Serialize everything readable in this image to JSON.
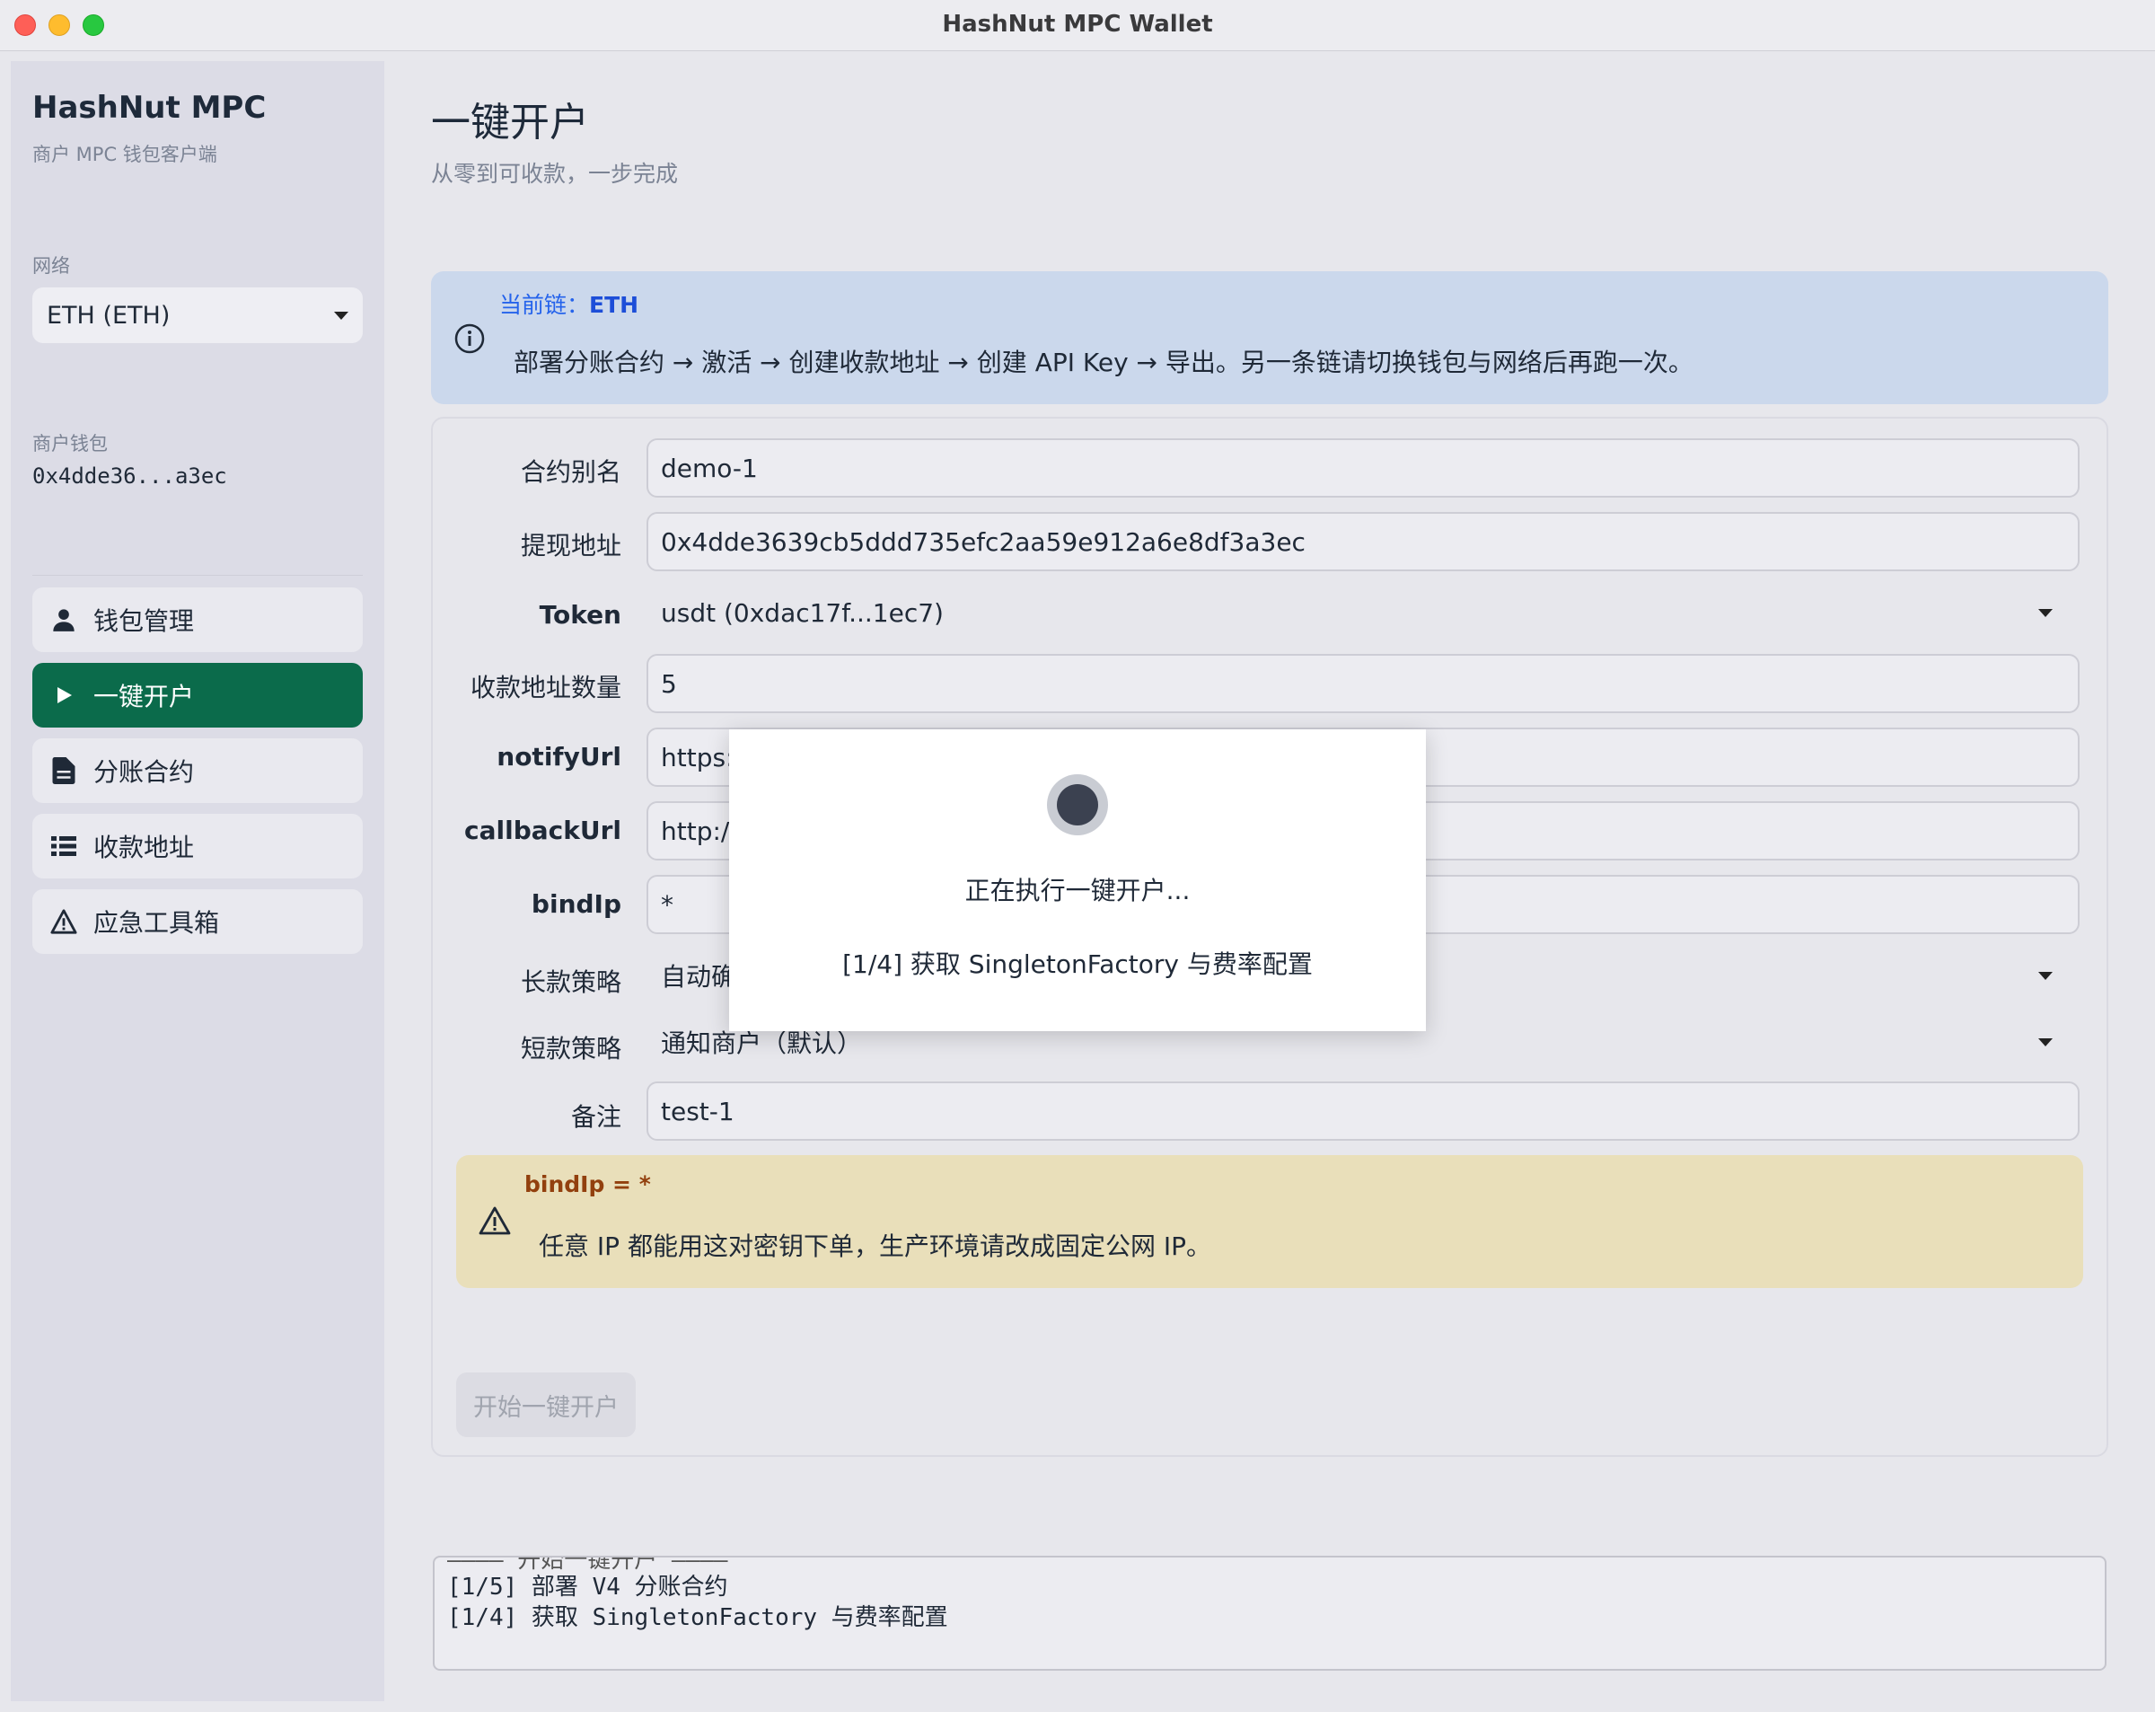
{
  "window": {
    "title": "HashNut MPC Wallet"
  },
  "sidebar": {
    "brand": "HashNut MPC",
    "brand_sub": "商户 MPC 钱包客户端",
    "network_label": "网络",
    "network_value": "ETH (ETH)",
    "wallet_label": "商户钱包",
    "wallet_address": "0x4dde36...a3ec",
    "items": [
      {
        "label": "钱包管理",
        "icon": "user-icon"
      },
      {
        "label": "一键开户",
        "icon": "play-icon",
        "active": true
      },
      {
        "label": "分账合约",
        "icon": "document-icon"
      },
      {
        "label": "收款地址",
        "icon": "list-icon"
      },
      {
        "label": "应急工具箱",
        "icon": "warning-icon"
      }
    ]
  },
  "main": {
    "title": "一键开户",
    "subtitle": "从零到可收款，一步完成",
    "info": {
      "title_prefix": "当前链：",
      "title_chain": "ETH",
      "body": "部署分账合约 → 激活 → 创建收款地址 → 创建 API Key → 导出。另一条链请切换钱包与网络后再跑一次。"
    },
    "form": {
      "alias": {
        "label": "合约别名",
        "value": "demo-1"
      },
      "withdraw": {
        "label": "提现地址",
        "value": "0x4dde3639cb5ddd735efc2aa59e912a6e8df3a3ec"
      },
      "token": {
        "label": "Token",
        "value": "usdt (0xdac17f...1ec7)"
      },
      "count": {
        "label": "收款地址数量",
        "value": "5"
      },
      "notify": {
        "label": "notifyUrl",
        "value": "https:"
      },
      "callback": {
        "label": "callbackUrl",
        "value": "http:/"
      },
      "bindip": {
        "label": "bindIp",
        "value": "*"
      },
      "long_policy": {
        "label": "长款策略",
        "value": "自动确"
      },
      "short_policy": {
        "label": "短款策略",
        "value": "通知商户（默认）"
      },
      "remark": {
        "label": "备注",
        "value": "test-1"
      }
    },
    "warning": {
      "title": "bindIp = *",
      "body": "任意 IP 都能用这对密钥下单，生产环境请改成固定公网 IP。"
    },
    "start_button": "开始一键开户",
    "log": {
      "cut_line": "———— 开始一键开户 ————",
      "lines": [
        "[1/5] 部署 V4 分账合约",
        "[1/4] 获取 SingletonFactory 与费率配置"
      ]
    }
  },
  "modal": {
    "title": "正在执行一键开户...",
    "step": "[1/4] 获取 SingletonFactory 与费率配置"
  }
}
